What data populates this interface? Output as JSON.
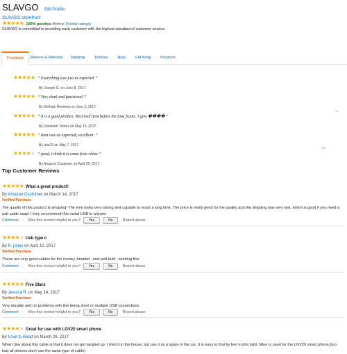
{
  "header": {
    "store_name": "SLAVGO",
    "edit_profile": "Edit Profile",
    "storefront": "SLAVGO storefront",
    "stars": 5,
    "positive": "100% positive",
    "lifetime": "lifetime",
    "ratings_count": "(5 total ratings)",
    "commitment": "SLAVGO is committed to providing each customer with the highest standard of customer service."
  },
  "tabs": [
    {
      "label": "Feedback",
      "active": true
    },
    {
      "label": "Returns & Refunds"
    },
    {
      "label": "Shipping"
    },
    {
      "label": "Policies"
    },
    {
      "label": "Help"
    },
    {
      "label": "Gift Wrap"
    },
    {
      "label": "Products"
    }
  ],
  "feedback": [
    {
      "stars": 5,
      "quote": "“ Everything was just as expected ”",
      "by": "By Joseph G. on June 8, 2017."
    },
    {
      "stars": 5,
      "quote": "“ Very sleek and functional ”",
      "by": "By Michael Renteria on June 2, 2017."
    },
    {
      "stars": 5,
      "quote": "“ It is a good product. Received item before the time frame. I give ���� ”",
      "by": "By Elizabeth Temez on May 10, 2017."
    },
    {
      "stars": 5,
      "quote": "“ Item was as expected; excellent. ”",
      "by": "By aha23 on May 7, 2017."
    },
    {
      "stars": 4,
      "quote": "“ good, i think it is come from china ”",
      "by": "By Amazon Customer on April 20, 2017."
    }
  ],
  "top_reviews": {
    "heading": "Top Customer Reviews",
    "helpful_question": "Was this review helpful to you?",
    "yes": "Yes",
    "no": "No",
    "report": "Report abuse",
    "comment": "Comment",
    "items": [
      {
        "stars": 5,
        "title": "What a great product!",
        "by_prefix": "By",
        "author": "Amazon Customer",
        "date": "on March 14, 2017",
        "verified": "Verified Purchase",
        "body": "The quality of this product is amazing! The wire looks very strong and capable to resist a long time. The price is really good for the quality and the shipping was very fast, which is good if you need a usb cable asap! I truly recommend this metal USB to anyone."
      },
      {
        "stars": 4,
        "title": "Usb type c",
        "by_prefix": "By",
        "author": "K. jones",
        "date": "on April 10, 2017",
        "verified": "Verified Purchase",
        "body": "These are very good cables for the money, braided , and well built , working fine"
      },
      {
        "stars": 5,
        "title": "Five Stars",
        "by_prefix": "By",
        "author": "Jessica R.",
        "date": "on May 14, 2017",
        "verified": "Verified Purchase",
        "body": "Very durable and no problems with line being short or multiple USB connections"
      },
      {
        "stars": 4,
        "title": "Great for use with LGV20 smart phone",
        "by_prefix": "By",
        "author": "Love to Read",
        "date": "on March 28, 2017",
        "verified": "",
        "body": "What I like about this cable is that it does not get tangled up. I tried it in the house, but use it as a spare in the car. It is easy to find by feel in dim light. Mine is used for the LGV20 smart phone,(too bad all phones don't use the same type of cable)"
      }
    ]
  },
  "colors": {
    "star": "#f0a900",
    "link": "#0066c0",
    "verified": "#c45500",
    "positive": "#007600"
  }
}
